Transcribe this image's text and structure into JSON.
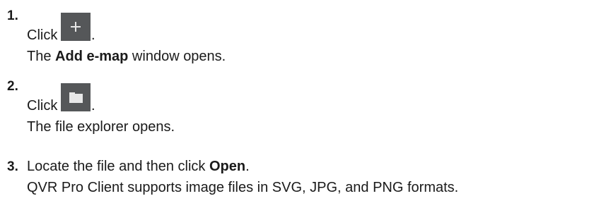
{
  "steps": [
    {
      "number": "1.",
      "prefix": "Click",
      "icon": "plus-icon",
      "suffix": ".",
      "result_prefix": "The ",
      "result_bold": "Add e-map",
      "result_suffix": " window opens."
    },
    {
      "number": "2.",
      "prefix": "Click",
      "icon": "folder-icon",
      "suffix": ".",
      "result": "The file explorer opens."
    },
    {
      "number": "3.",
      "prefix": "Locate the file and then click ",
      "bold": "Open",
      "suffix": ".",
      "note": "QVR Pro Client supports image files in SVG, JPG, and PNG formats."
    }
  ],
  "colors": {
    "text": "#1a1a1a",
    "icon_bg": "#555759",
    "icon_fg": "#e6e6e6"
  }
}
